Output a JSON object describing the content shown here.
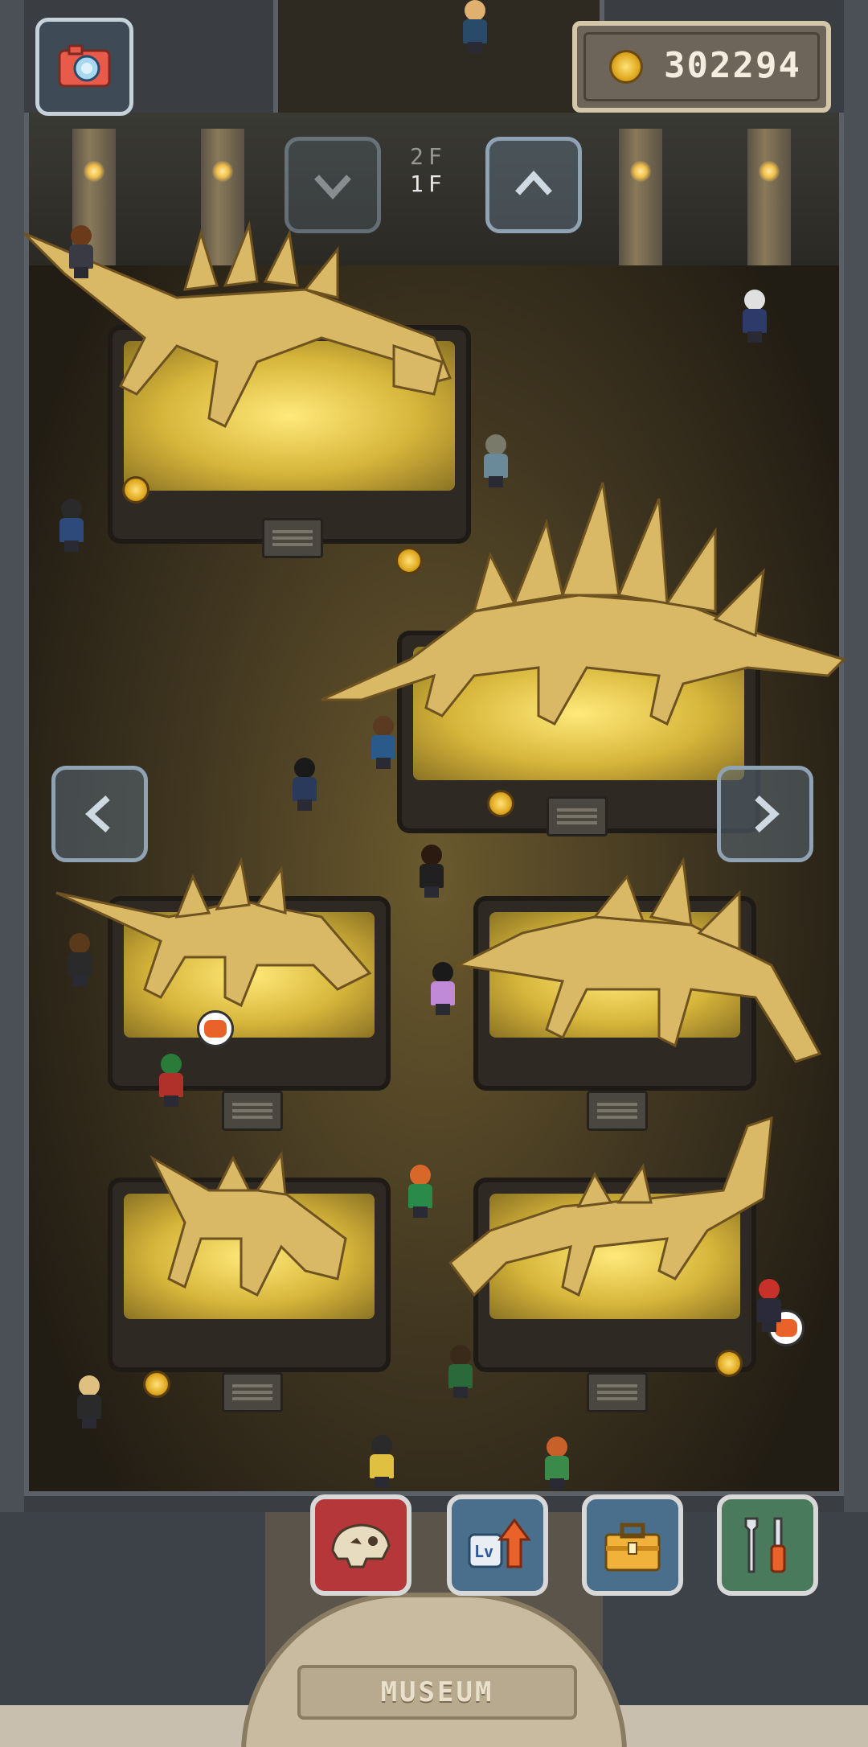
{
  "hud": {
    "coins": "302294",
    "floor_upper": "2F",
    "floor_current": "1F"
  },
  "entrance": {
    "sign": "MUSEUM"
  },
  "icons": {
    "camera": "camera-icon",
    "coin": "coin-icon",
    "floor_down": "chevron-down-icon",
    "floor_up": "chevron-up-icon",
    "pan_left": "chevron-left-icon",
    "pan_right": "chevron-right-icon",
    "fossil": "fossil-skull-icon",
    "level_up": "level-up-icon",
    "shop": "toolbox-icon",
    "settings": "tools-icon"
  },
  "colors": {
    "fossil_button": "#b5373a",
    "levelup_button": "#4a6f8c",
    "shop_button": "#4a6f8c",
    "tools_button": "#4a7a5c",
    "spotlight": "#ffe97a"
  }
}
